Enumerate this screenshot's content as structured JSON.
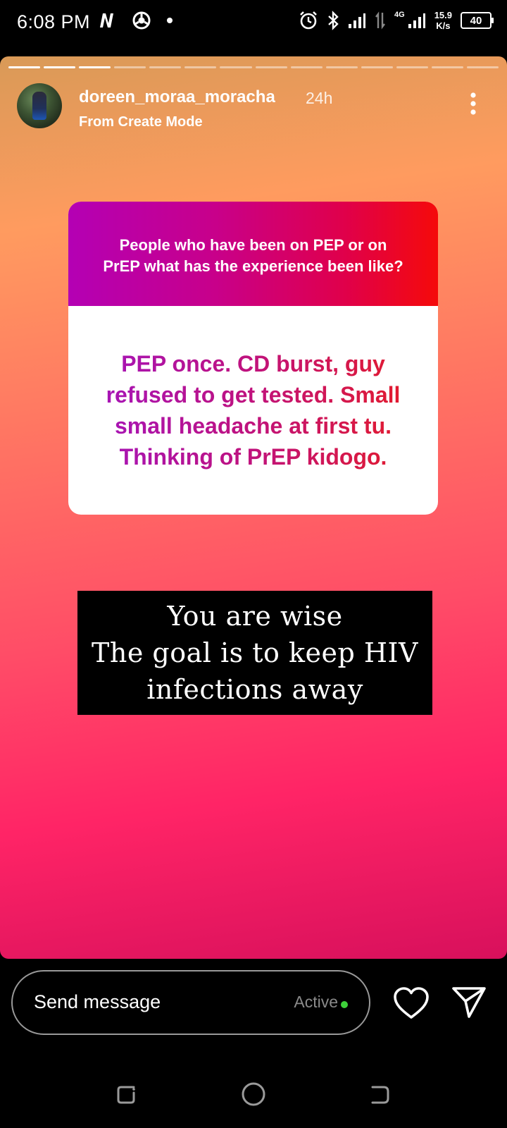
{
  "status_bar": {
    "time": "6:08 PM",
    "network_type": "4G",
    "speed_value": "15.9",
    "speed_unit": "K/s",
    "battery_level": "40",
    "icons": [
      "netflix-icon",
      "chrome-icon",
      "notification-dot-icon",
      "alarm-icon",
      "bluetooth-icon",
      "signal-icon",
      "data-transfer-icon",
      "signal-icon",
      "battery-icon"
    ]
  },
  "story": {
    "segments_total": 14,
    "segments_viewed": 3,
    "username": "doreen_moraa_moracha",
    "posted_ago": "24h",
    "subtitle": "From Create Mode",
    "question": "People who have been on PEP or on PrEP what has the experience been like?",
    "answer": "PEP once. CD burst, guy refused to get tested. Small small headache at first tu. Thinking of PrEP kidogo.",
    "caption_lines": [
      "You are wise",
      "The goal is to keep HIV",
      "infections away"
    ]
  },
  "reply_bar": {
    "placeholder": "Send message",
    "active_label": "Active",
    "active_color": "#3ed13a"
  },
  "nav_bar": {
    "icons": [
      "recent-apps-icon",
      "home-icon",
      "back-icon"
    ]
  }
}
